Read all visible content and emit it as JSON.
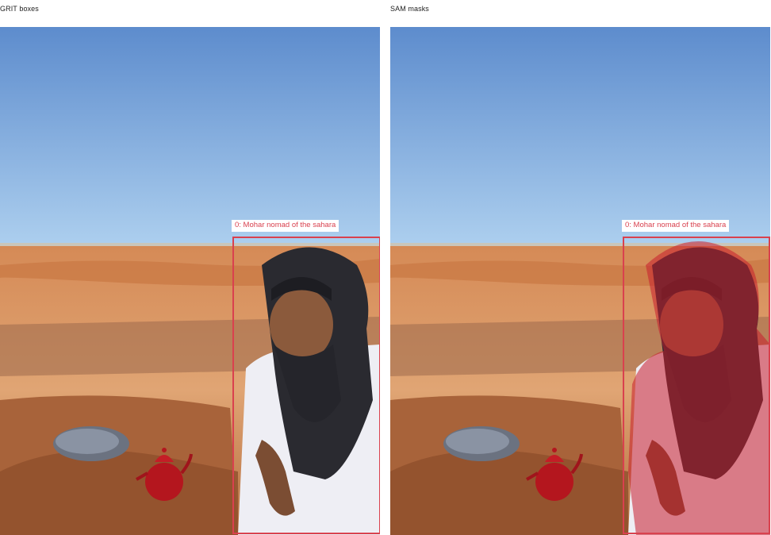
{
  "panels": {
    "left": {
      "title": "GRIT boxes"
    },
    "right": {
      "title": "SAM masks"
    }
  },
  "detections": [
    {
      "label": "0: Mohar nomad of the sahara",
      "color": "#d9414e"
    }
  ],
  "colors": {
    "box": "#d9414e",
    "mask": "rgba(190, 30, 45, 0.55)",
    "sky_top": "#5f8ecf",
    "sky_bottom": "#a9cdee",
    "sand": "#d38a52"
  }
}
